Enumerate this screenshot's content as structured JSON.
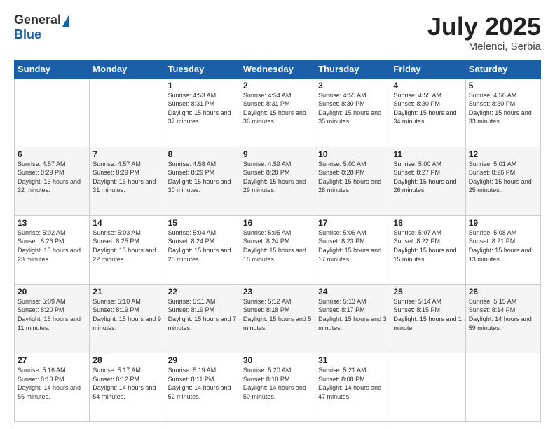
{
  "logo": {
    "general": "General",
    "blue": "Blue"
  },
  "header": {
    "month": "July 2025",
    "location": "Melenci, Serbia"
  },
  "days_of_week": [
    "Sunday",
    "Monday",
    "Tuesday",
    "Wednesday",
    "Thursday",
    "Friday",
    "Saturday"
  ],
  "weeks": [
    [
      {
        "day": "",
        "sunrise": "",
        "sunset": "",
        "daylight": ""
      },
      {
        "day": "",
        "sunrise": "",
        "sunset": "",
        "daylight": ""
      },
      {
        "day": "1",
        "sunrise": "Sunrise: 4:53 AM",
        "sunset": "Sunset: 8:31 PM",
        "daylight": "Daylight: 15 hours and 37 minutes."
      },
      {
        "day": "2",
        "sunrise": "Sunrise: 4:54 AM",
        "sunset": "Sunset: 8:31 PM",
        "daylight": "Daylight: 15 hours and 36 minutes."
      },
      {
        "day": "3",
        "sunrise": "Sunrise: 4:55 AM",
        "sunset": "Sunset: 8:30 PM",
        "daylight": "Daylight: 15 hours and 35 minutes."
      },
      {
        "day": "4",
        "sunrise": "Sunrise: 4:55 AM",
        "sunset": "Sunset: 8:30 PM",
        "daylight": "Daylight: 15 hours and 34 minutes."
      },
      {
        "day": "5",
        "sunrise": "Sunrise: 4:56 AM",
        "sunset": "Sunset: 8:30 PM",
        "daylight": "Daylight: 15 hours and 33 minutes."
      }
    ],
    [
      {
        "day": "6",
        "sunrise": "Sunrise: 4:57 AM",
        "sunset": "Sunset: 8:29 PM",
        "daylight": "Daylight: 15 hours and 32 minutes."
      },
      {
        "day": "7",
        "sunrise": "Sunrise: 4:57 AM",
        "sunset": "Sunset: 8:29 PM",
        "daylight": "Daylight: 15 hours and 31 minutes."
      },
      {
        "day": "8",
        "sunrise": "Sunrise: 4:58 AM",
        "sunset": "Sunset: 8:29 PM",
        "daylight": "Daylight: 15 hours and 30 minutes."
      },
      {
        "day": "9",
        "sunrise": "Sunrise: 4:59 AM",
        "sunset": "Sunset: 8:28 PM",
        "daylight": "Daylight: 15 hours and 29 minutes."
      },
      {
        "day": "10",
        "sunrise": "Sunrise: 5:00 AM",
        "sunset": "Sunset: 8:28 PM",
        "daylight": "Daylight: 15 hours and 28 minutes."
      },
      {
        "day": "11",
        "sunrise": "Sunrise: 5:00 AM",
        "sunset": "Sunset: 8:27 PM",
        "daylight": "Daylight: 15 hours and 26 minutes."
      },
      {
        "day": "12",
        "sunrise": "Sunrise: 5:01 AM",
        "sunset": "Sunset: 8:26 PM",
        "daylight": "Daylight: 15 hours and 25 minutes."
      }
    ],
    [
      {
        "day": "13",
        "sunrise": "Sunrise: 5:02 AM",
        "sunset": "Sunset: 8:26 PM",
        "daylight": "Daylight: 15 hours and 23 minutes."
      },
      {
        "day": "14",
        "sunrise": "Sunrise: 5:03 AM",
        "sunset": "Sunset: 8:25 PM",
        "daylight": "Daylight: 15 hours and 22 minutes."
      },
      {
        "day": "15",
        "sunrise": "Sunrise: 5:04 AM",
        "sunset": "Sunset: 8:24 PM",
        "daylight": "Daylight: 15 hours and 20 minutes."
      },
      {
        "day": "16",
        "sunrise": "Sunrise: 5:05 AM",
        "sunset": "Sunset: 8:24 PM",
        "daylight": "Daylight: 15 hours and 18 minutes."
      },
      {
        "day": "17",
        "sunrise": "Sunrise: 5:06 AM",
        "sunset": "Sunset: 8:23 PM",
        "daylight": "Daylight: 15 hours and 17 minutes."
      },
      {
        "day": "18",
        "sunrise": "Sunrise: 5:07 AM",
        "sunset": "Sunset: 8:22 PM",
        "daylight": "Daylight: 15 hours and 15 minutes."
      },
      {
        "day": "19",
        "sunrise": "Sunrise: 5:08 AM",
        "sunset": "Sunset: 8:21 PM",
        "daylight": "Daylight: 15 hours and 13 minutes."
      }
    ],
    [
      {
        "day": "20",
        "sunrise": "Sunrise: 5:09 AM",
        "sunset": "Sunset: 8:20 PM",
        "daylight": "Daylight: 15 hours and 11 minutes."
      },
      {
        "day": "21",
        "sunrise": "Sunrise: 5:10 AM",
        "sunset": "Sunset: 8:19 PM",
        "daylight": "Daylight: 15 hours and 9 minutes."
      },
      {
        "day": "22",
        "sunrise": "Sunrise: 5:11 AM",
        "sunset": "Sunset: 8:19 PM",
        "daylight": "Daylight: 15 hours and 7 minutes."
      },
      {
        "day": "23",
        "sunrise": "Sunrise: 5:12 AM",
        "sunset": "Sunset: 8:18 PM",
        "daylight": "Daylight: 15 hours and 5 minutes."
      },
      {
        "day": "24",
        "sunrise": "Sunrise: 5:13 AM",
        "sunset": "Sunset: 8:17 PM",
        "daylight": "Daylight: 15 hours and 3 minutes."
      },
      {
        "day": "25",
        "sunrise": "Sunrise: 5:14 AM",
        "sunset": "Sunset: 8:15 PM",
        "daylight": "Daylight: 15 hours and 1 minute."
      },
      {
        "day": "26",
        "sunrise": "Sunrise: 5:15 AM",
        "sunset": "Sunset: 8:14 PM",
        "daylight": "Daylight: 14 hours and 59 minutes."
      }
    ],
    [
      {
        "day": "27",
        "sunrise": "Sunrise: 5:16 AM",
        "sunset": "Sunset: 8:13 PM",
        "daylight": "Daylight: 14 hours and 56 minutes."
      },
      {
        "day": "28",
        "sunrise": "Sunrise: 5:17 AM",
        "sunset": "Sunset: 8:12 PM",
        "daylight": "Daylight: 14 hours and 54 minutes."
      },
      {
        "day": "29",
        "sunrise": "Sunrise: 5:19 AM",
        "sunset": "Sunset: 8:11 PM",
        "daylight": "Daylight: 14 hours and 52 minutes."
      },
      {
        "day": "30",
        "sunrise": "Sunrise: 5:20 AM",
        "sunset": "Sunset: 8:10 PM",
        "daylight": "Daylight: 14 hours and 50 minutes."
      },
      {
        "day": "31",
        "sunrise": "Sunrise: 5:21 AM",
        "sunset": "Sunset: 8:08 PM",
        "daylight": "Daylight: 14 hours and 47 minutes."
      },
      {
        "day": "",
        "sunrise": "",
        "sunset": "",
        "daylight": ""
      },
      {
        "day": "",
        "sunrise": "",
        "sunset": "",
        "daylight": ""
      }
    ]
  ]
}
